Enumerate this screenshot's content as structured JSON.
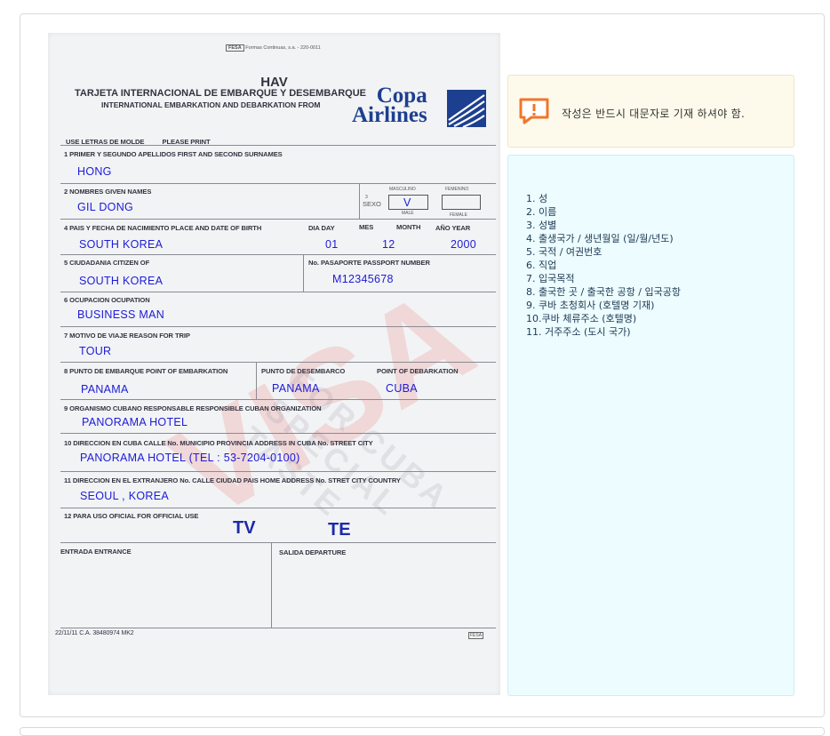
{
  "form": {
    "top_line": "Formas Continuas, s.a. - 220-0011",
    "top_brand": "FESA",
    "code": "HAV",
    "title_es": "TARJETA INTERNACIONAL DE EMBARQUE Y DESEMBARQUE",
    "title_en": "INTERNATIONAL EMBARKATION AND DEBARKATION FROM",
    "airline_line1": "Copa",
    "airline_line2": "Airlines",
    "use_letters": "USE LETRAS DE MOLDE",
    "please_print": "PLEASE PRINT",
    "f1_label": "1  PRIMER Y SEGUNDO APELLIDOS    FIRST AND SECOND SURNAMES",
    "f1_value": "HONG",
    "f2_label": "2  NOMBRES   GIVEN NAMES",
    "f2_value": "GIL DONG",
    "f3_num": "3",
    "f3_sexo": "SEXO",
    "f3_masculino": "MASCULINO",
    "f3_femenino": "FEMENINO",
    "f3_male": "MALE",
    "f3_female": "FEMALE",
    "f3_value": "V",
    "f4_label": "4  PAIS Y FECHA DE NACIMIENTO    PLACE AND DATE OF BIRTH",
    "f4_dia": "DIA   DAY",
    "f4_mes": "MES",
    "f4_month": "MONTH",
    "f4_ano": "AÑO    YEAR",
    "f4_value": "SOUTH KOREA",
    "f4_day": "01",
    "f4_month_value": "12",
    "f4_year": "2000",
    "f5_label": "5  CIUDADANIA    CITIZEN OF",
    "f5_pass_label": "No. PASAPORTE     PASSPORT NUMBER",
    "f5_value": "SOUTH KOREA",
    "f5_passport": "M12345678",
    "f6_label": "6  OCUPACION   OCUPATION",
    "f6_value": "BUSINESS MAN",
    "f7_label": "7  MOTIVO DE VIAJE    REASON FOR TRIP",
    "f7_value": "TOUR",
    "f8_label": "8  PUNTO DE EMBARQUE   POINT OF EMBARKATION",
    "f8_label2": "PUNTO DE DESEMBARCO",
    "f8_label3": "POINT OF DEBARKATION",
    "f8_value1": "PANAMA",
    "f8_value2": "PANAMA",
    "f8_value3": "CUBA",
    "f9_label": "9  ORGANISMO CUBANO RESPONSABLE      RESPONSIBLE CUBAN ORGANIZATION",
    "f9_value": "PANORAMA HOTEL",
    "f10_label": "10  DIRECCION EN CUBA     CALLE No.       MUNICIPIO    PROVINCIA       ADDRESS IN  CUBA     No.       STREET     CITY",
    "f10_value": "PANORAMA HOTEL (TEL : 53-7204-0100)",
    "f11_label": "11  DIRECCION EN EL EXTRANJERO    No. CALLE    CIUDAD    PAIS    HOME ADDRESS   No.    STRET     CITY    COUNTRY",
    "f11_value": "SEOUL , KOREA",
    "f12_label": "12  PARA USO OFICIAL       FOR OFFICIAL USE",
    "f12_tv": "TV",
    "f12_te": "TE",
    "entrada": "ENTRADA      ENTRANCE",
    "salida": "SALIDA     DEPARTURE",
    "footer": "22/11/11 C.A. 38480974 MK2",
    "footer_brand": "FESA",
    "watermark": "VISA",
    "watermark2": "FOR CUBA SPECIAL TASTE"
  },
  "notice": {
    "icon": "exclamation-icon",
    "text": "작성은 반드시 대문자로 기재 하셔야 함."
  },
  "list": {
    "items": [
      "1. 성",
      "2. 이름",
      "3. 성별",
      "4. 출생국가 / 생년월일 (일/월/년도)",
      "5. 국적 / 여권번호",
      "6. 직업",
      "7. 입국목적",
      "8. 출국한 곳 / 출국한 공항 / 입국공항",
      "9. 쿠바 초청회사 (호텔명 기재)",
      "10.쿠바 체류주소 (호텔명)",
      "11. 거주주소 (도시 국가)"
    ]
  },
  "colors": {
    "notice_bg": "#fdfaeb",
    "notice_icon": "#f0762a",
    "list_bg": "#ecfcff",
    "filled_ink": "#1c1cd6"
  }
}
